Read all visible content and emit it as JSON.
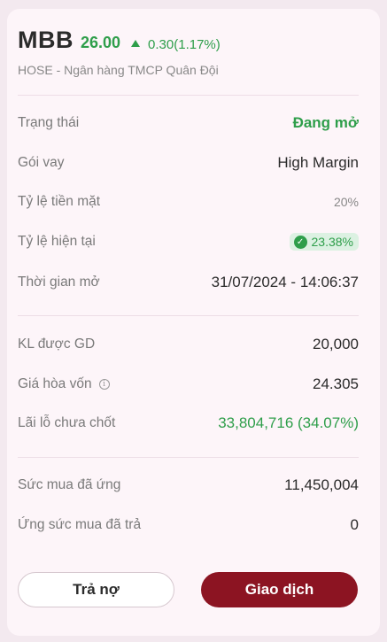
{
  "header": {
    "ticker": "MBB",
    "price": "26.00",
    "change": "0.30(1.17%)",
    "subtitle": "HOSE - Ngân hàng TMCP Quân Đội"
  },
  "section1": {
    "status_label": "Trạng thái",
    "status_value": "Đang mở",
    "loan_label": "Gói vay",
    "loan_value": "High Margin",
    "cash_ratio_label": "Tỷ lệ tiền mặt",
    "cash_ratio_value": "20%",
    "current_ratio_label": "Tỷ lệ hiện tại",
    "current_ratio_value": "23.38%",
    "open_time_label": "Thời gian mở",
    "open_time_value": "31/07/2024 - 14:06:37"
  },
  "section2": {
    "volume_label": "KL được GD",
    "volume_value": "20,000",
    "breakeven_label": "Giá hòa vốn",
    "breakeven_value": "24.305",
    "unrealized_label": "Lãi lỗ chưa chốt",
    "unrealized_value": "33,804,716 (34.07%)"
  },
  "section3": {
    "advance_label": "Sức mua đã ứng",
    "advance_value": "11,450,004",
    "repaid_label": "Ứng sức mua đã trả",
    "repaid_value": "0"
  },
  "buttons": {
    "repay": "Trả nợ",
    "trade": "Giao dịch"
  },
  "colors": {
    "positive": "#2e9e4a",
    "primary_button": "#8c1422"
  },
  "icons": {
    "change_direction": "triangle-up-icon",
    "ratio_ok": "check-circle-icon",
    "breakeven_info": "info-icon"
  }
}
